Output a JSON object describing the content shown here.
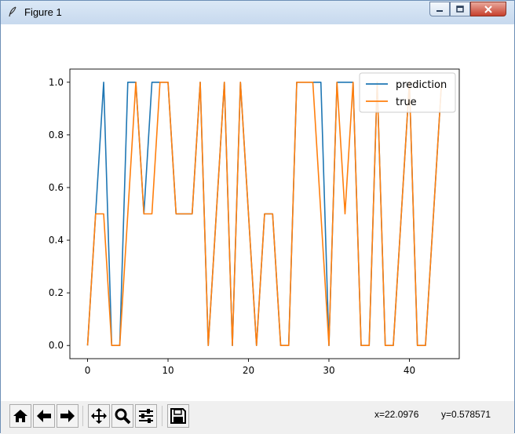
{
  "window": {
    "title": "Figure 1",
    "buttons": [
      {
        "name": "minimize",
        "icon": "minimize-icon"
      },
      {
        "name": "maximize",
        "icon": "maximize-icon"
      },
      {
        "name": "close",
        "icon": "close-icon"
      }
    ]
  },
  "toolbar": {
    "tools": [
      {
        "name": "home",
        "icon": "home-icon"
      },
      {
        "name": "back",
        "icon": "arrow-left-icon"
      },
      {
        "name": "forward",
        "icon": "arrow-right-icon"
      },
      {
        "name": "pan",
        "icon": "move-icon"
      },
      {
        "name": "zoom",
        "icon": "magnifier-icon"
      },
      {
        "name": "configure",
        "icon": "sliders-icon"
      },
      {
        "name": "save",
        "icon": "floppy-disk-icon"
      }
    ],
    "coord_x": "x=22.0976",
    "coord_y": "y=0.578571"
  },
  "chart_data": {
    "type": "line",
    "title": "",
    "xlabel": "",
    "ylabel": "",
    "xlim": [
      -2.2,
      46.2
    ],
    "ylim": [
      -0.05,
      1.05
    ],
    "xticks": [
      0,
      10,
      20,
      30,
      40
    ],
    "yticks": [
      0.0,
      0.2,
      0.4,
      0.6,
      0.8,
      1.0
    ],
    "xtick_labels": [
      "0",
      "10",
      "20",
      "30",
      "40"
    ],
    "ytick_labels": [
      "0.0",
      "0.2",
      "0.4",
      "0.6",
      "0.8",
      "1.0"
    ],
    "legend": "top-right",
    "series": [
      {
        "name": "prediction",
        "color": "#1f77b4",
        "x": [
          0,
          1,
          2,
          3,
          4,
          5,
          6,
          7,
          8,
          9,
          10,
          11,
          12,
          13,
          14,
          15,
          16,
          17,
          18,
          19,
          20,
          21,
          22,
          23,
          24,
          25,
          26,
          27,
          28,
          29,
          30,
          31,
          32,
          33,
          34,
          35,
          36,
          37,
          38,
          39,
          40,
          41,
          42,
          43,
          44
        ],
        "values": [
          0,
          0.5,
          1,
          0,
          0,
          1,
          1,
          0.5,
          1,
          1,
          1,
          0.5,
          0.5,
          0.5,
          1,
          0,
          0.5,
          1,
          0,
          1,
          0.5,
          0,
          0.5,
          0.5,
          0,
          0,
          1,
          1,
          1,
          1,
          0,
          1,
          1,
          1,
          0,
          0,
          1,
          0,
          0,
          0.5,
          1,
          0,
          0,
          0.5,
          1
        ]
      },
      {
        "name": "true",
        "color": "#ff7f0e",
        "x": [
          0,
          1,
          2,
          3,
          4,
          5,
          6,
          7,
          8,
          9,
          10,
          11,
          12,
          13,
          14,
          15,
          16,
          17,
          18,
          19,
          20,
          21,
          22,
          23,
          24,
          25,
          26,
          27,
          28,
          29,
          30,
          31,
          32,
          33,
          34,
          35,
          36,
          37,
          38,
          39,
          40,
          41,
          42,
          43,
          44
        ],
        "values": [
          0,
          0.5,
          0.5,
          0,
          0,
          0.5,
          1,
          0.5,
          0.5,
          1,
          1,
          0.5,
          0.5,
          0.5,
          1,
          0,
          0.5,
          1,
          0,
          1,
          0.5,
          0,
          0.5,
          0.5,
          0,
          0,
          1,
          1,
          1,
          0.5,
          0,
          1,
          0.5,
          1,
          0,
          0,
          1,
          0,
          0,
          0.5,
          1,
          0,
          0,
          0.5,
          1
        ]
      }
    ]
  }
}
